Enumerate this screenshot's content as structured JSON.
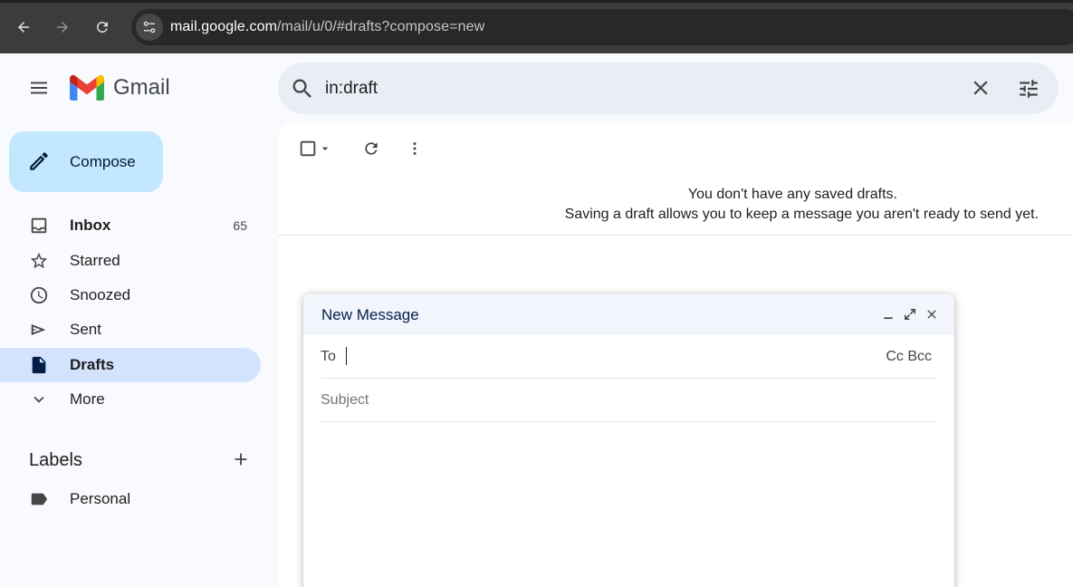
{
  "browser": {
    "url_host": "mail.google.com",
    "url_path": "/mail/u/0/#drafts?compose=new"
  },
  "app": {
    "name": "Gmail"
  },
  "search": {
    "query": "in:draft"
  },
  "compose_button": {
    "label": "Compose"
  },
  "sidebar": {
    "items": [
      {
        "label": "Inbox",
        "count": "65"
      },
      {
        "label": "Starred"
      },
      {
        "label": "Snoozed"
      },
      {
        "label": "Sent"
      },
      {
        "label": "Drafts"
      },
      {
        "label": "More"
      }
    ],
    "labels_title": "Labels",
    "labels": [
      {
        "label": "Personal"
      }
    ]
  },
  "main": {
    "empty_title": "You don't have any saved drafts.",
    "empty_subtitle": "Saving a draft allows you to keep a message you aren't ready to send yet."
  },
  "compose_window": {
    "title": "New Message",
    "to_label": "To",
    "cc_bcc": "Cc Bcc",
    "subject_placeholder": "Subject"
  },
  "colors": {
    "compose_bg": "#c2e7ff",
    "active_nav_bg": "#d3e3fd",
    "search_bg": "#e9eef6",
    "page_bg": "#f8fafd"
  },
  "icons": {
    "back": "arrow-left-icon",
    "forward": "arrow-right-icon",
    "reload": "reload-icon",
    "site_info": "tune-icon",
    "menu": "hamburger-icon",
    "search": "search-icon",
    "clear": "close-icon",
    "filters": "sliders-icon"
  }
}
